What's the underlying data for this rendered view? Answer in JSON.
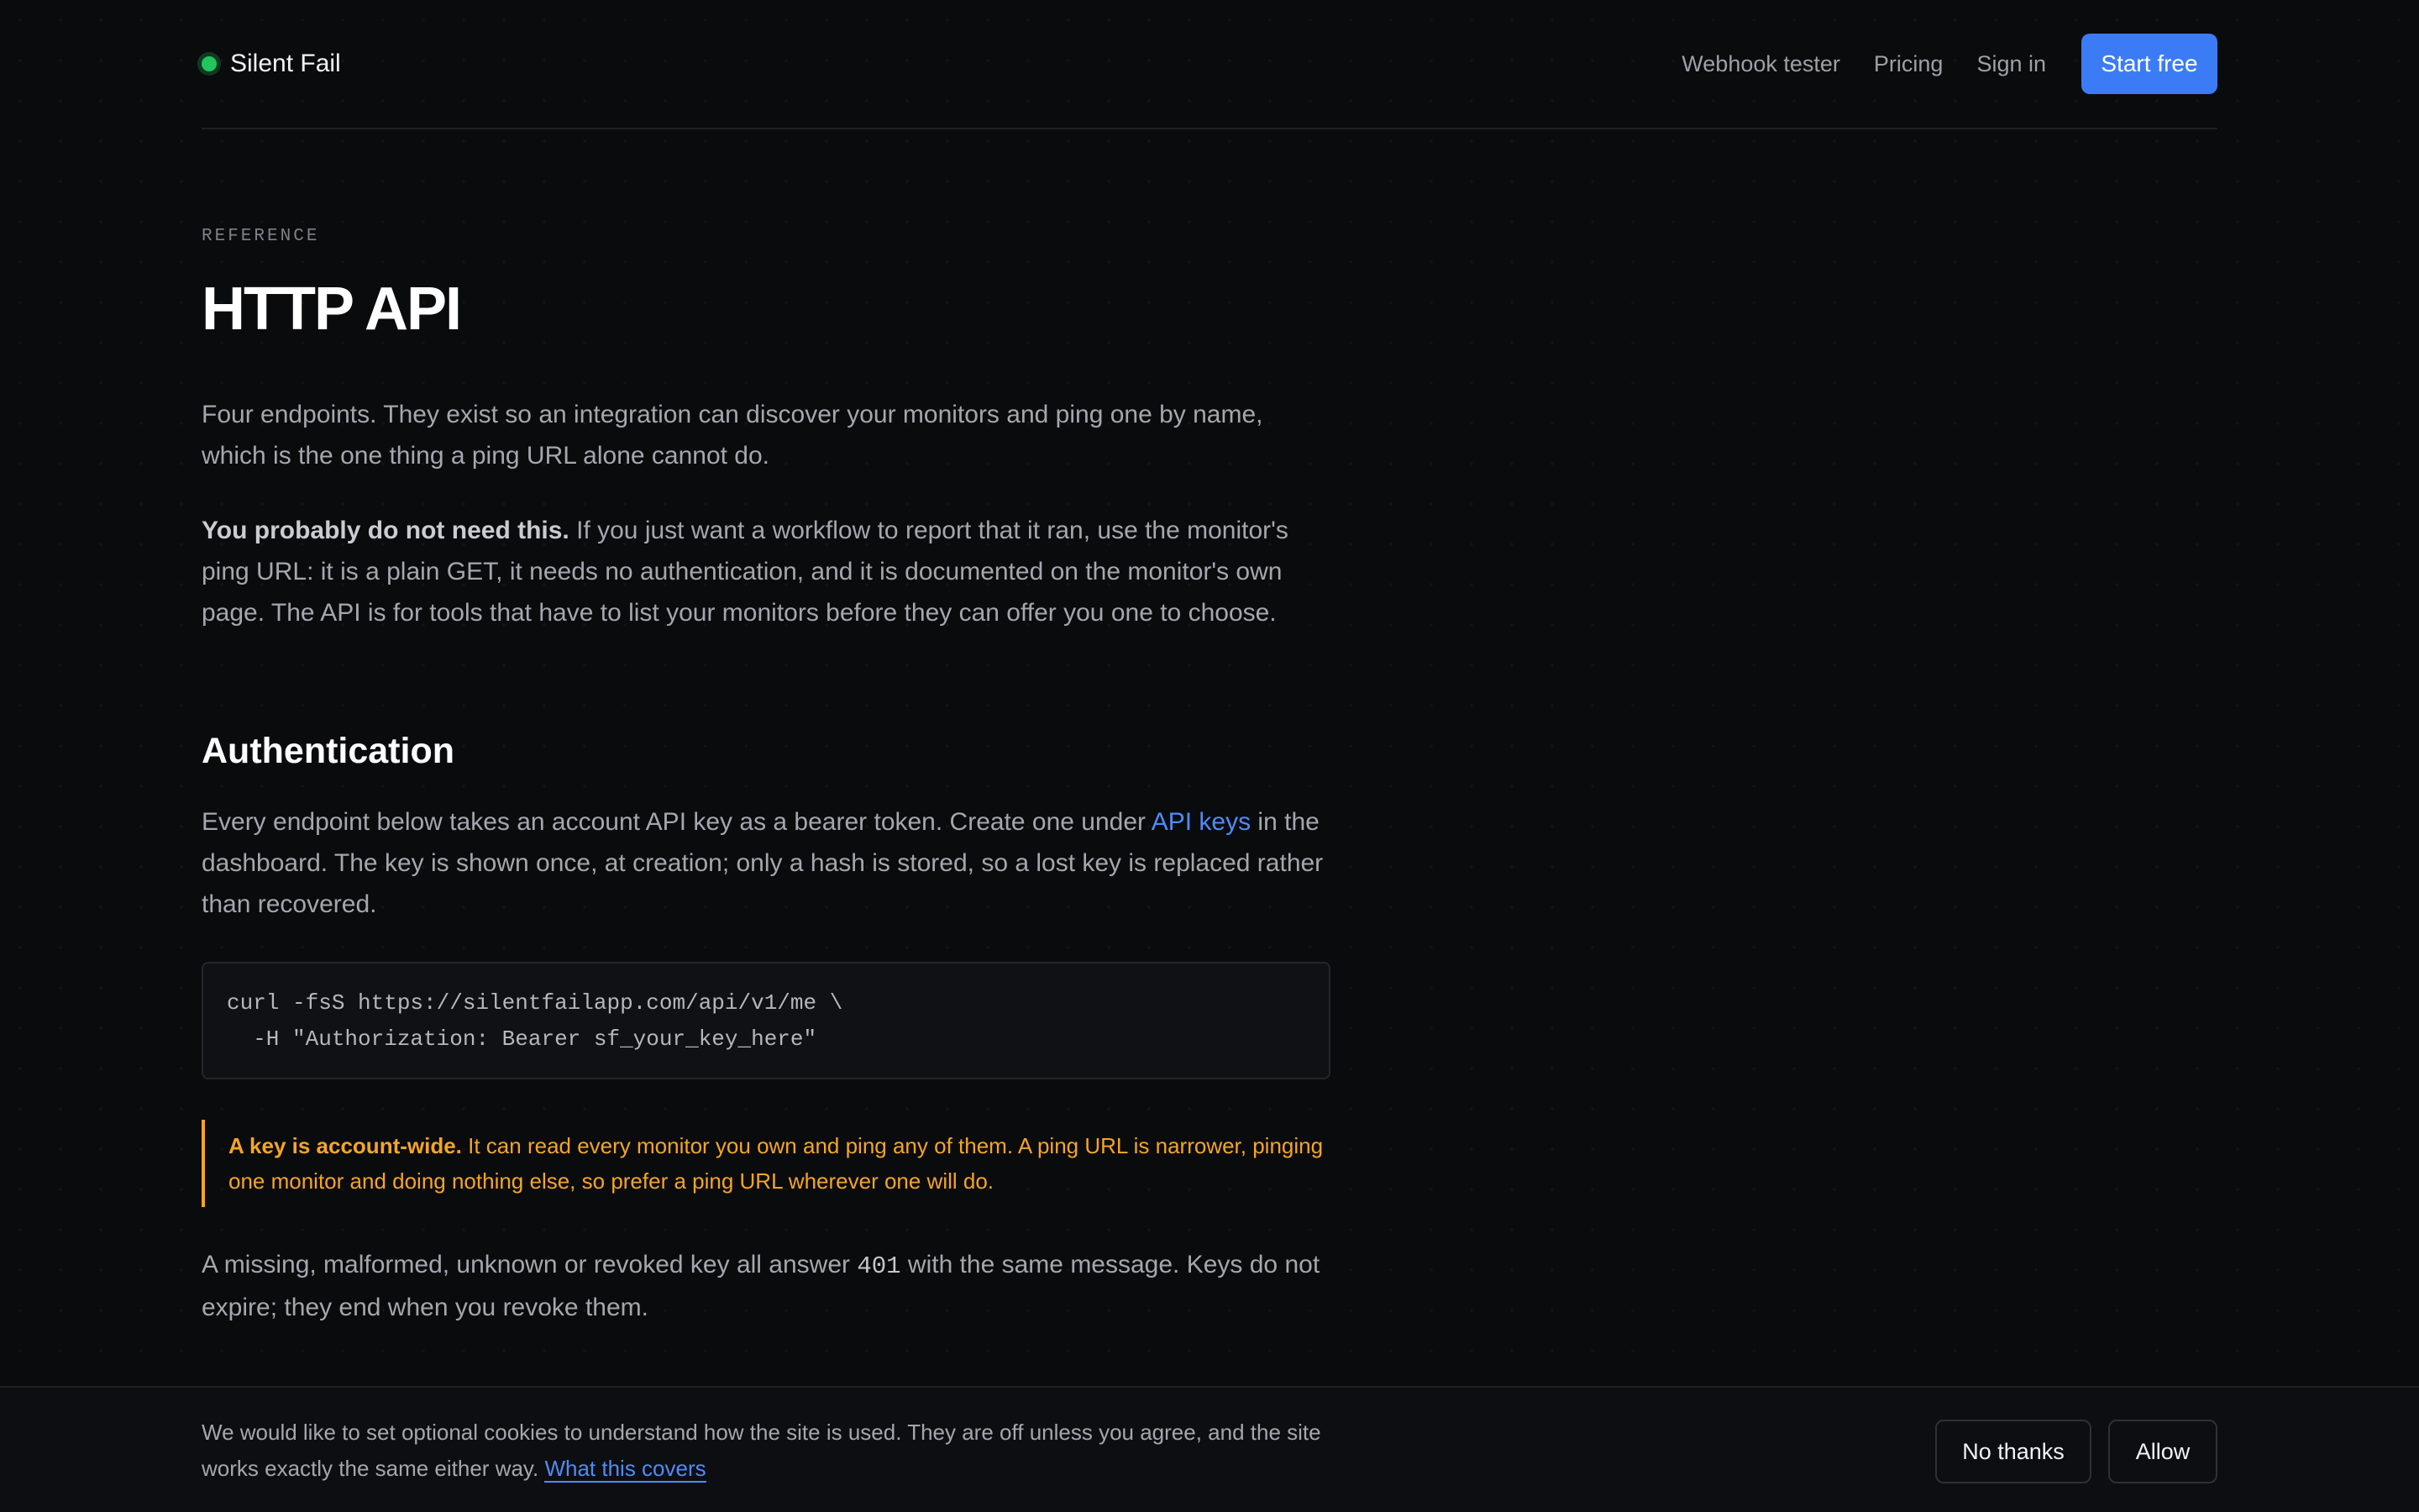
{
  "header": {
    "brand": "Silent Fail",
    "nav": {
      "webhook_tester": "Webhook tester",
      "pricing": "Pricing",
      "sign_in": "Sign in",
      "start_free": "Start free"
    }
  },
  "colors": {
    "accent": "#3b7cf6",
    "status_green": "#22c55e",
    "warning": "#f5a524",
    "background": "#0a0b0d"
  },
  "main": {
    "eyebrow": "REFERENCE",
    "title": "HTTP API",
    "intro": "Four endpoints. They exist so an integration can discover your monitors and ping one by name, which is the one thing a ping URL alone cannot do.",
    "note_bold": "You probably do not need this.",
    "note_rest": " If you just want a workflow to report that it ran, use the monitor's ping URL: it is a plain GET, it needs no authentication, and it is documented on the monitor's own page. The API is for tools that have to list your monitors before they can offer you one to choose.",
    "auth": {
      "heading": "Authentication",
      "text_before_link": "Every endpoint below takes an account API key as a bearer token. Create one under ",
      "link": "API keys",
      "text_after_link": " in the dashboard. The key is shown once, at creation; only a hash is stored, so a lost key is replaced rather than recovered.",
      "code_line1": "curl -fsS https://silentfailapp.com/api/v1/me \\",
      "code_line2": "  -H \"Authorization: Bearer sf_your_key_here\"",
      "callout_bold": "A key is account-wide.",
      "callout_rest": " It can read every monitor you own and ping any of them. A ping URL is narrower, pinging one monitor and doing nothing else, so prefer a ping URL wherever one will do.",
      "para_before_code": "A missing, malformed, unknown or revoked key all answer ",
      "para_code": "401",
      "para_after_code": " with the same message. Keys do not expire; they end when you revoke them."
    }
  },
  "cookie": {
    "text": "We would like to set optional cookies to understand how the site is used. They are off unless you agree, and the site works exactly the same either way. ",
    "link": "What this covers",
    "no_thanks": "No thanks",
    "allow": "Allow"
  }
}
